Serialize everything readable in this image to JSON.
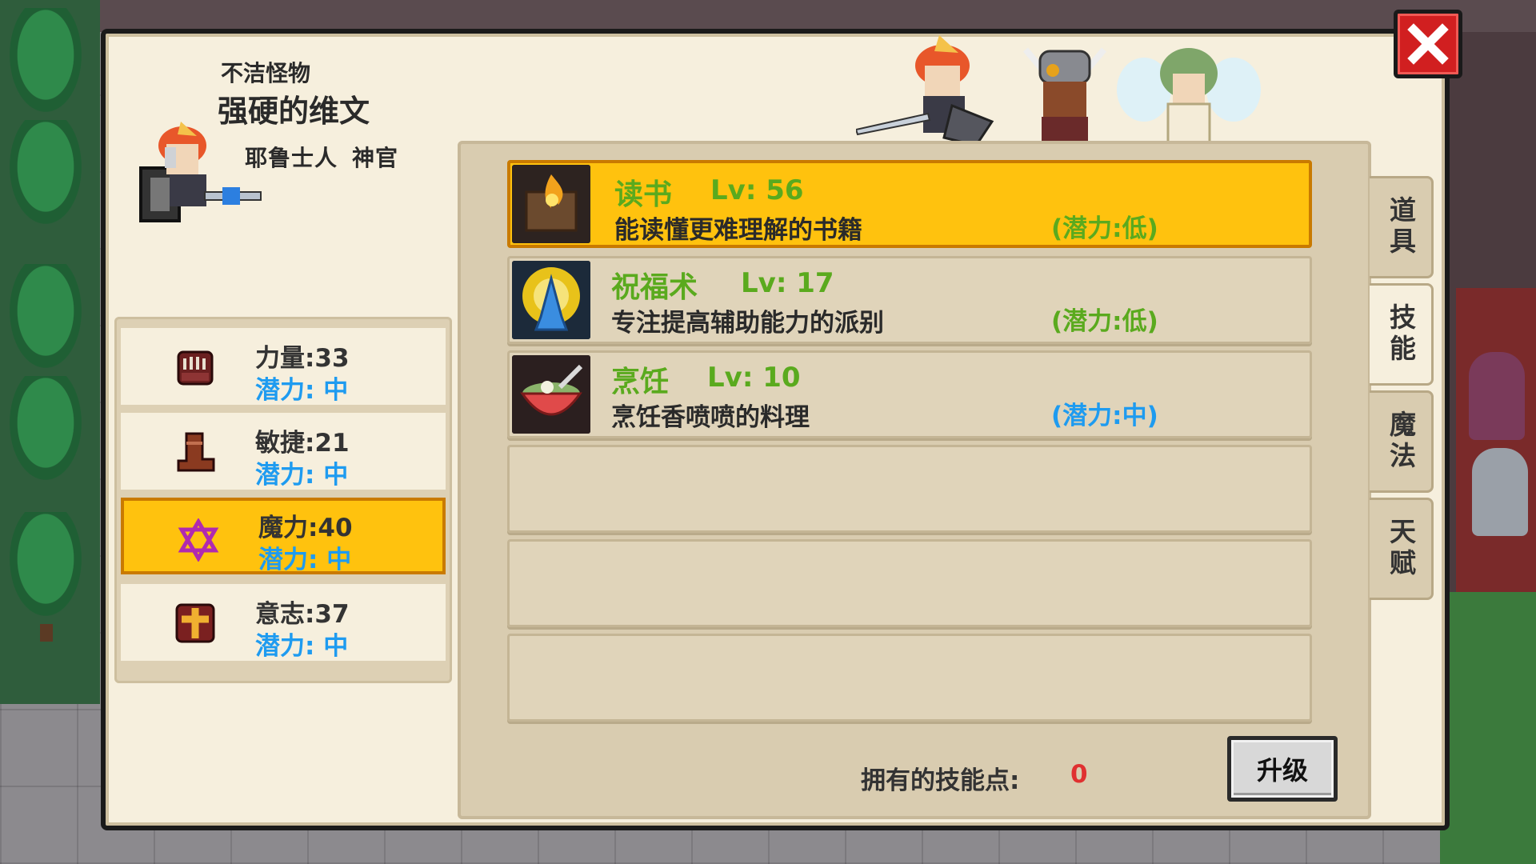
{
  "character": {
    "title": "不洁怪物",
    "name": "强硬的维文",
    "race": "耶鲁士人",
    "class": "神官"
  },
  "stats": [
    {
      "icon": "fist-icon",
      "name": "力量",
      "value": "33",
      "potential_label": "潜力",
      "potential": "中",
      "selected": false
    },
    {
      "icon": "boot-icon",
      "name": "敏捷",
      "value": "21",
      "potential_label": "潜力",
      "potential": "中",
      "selected": false
    },
    {
      "icon": "hexagram-icon",
      "name": "魔力",
      "value": "40",
      "potential_label": "潜力",
      "potential": "中",
      "selected": true
    },
    {
      "icon": "cross-shield-icon",
      "name": "意志",
      "value": "37",
      "potential_label": "潜力",
      "potential": "中",
      "selected": false
    }
  ],
  "skills": [
    {
      "icon": "book-fire-icon",
      "name": "读书",
      "level": "Lv: 56",
      "desc": "能读懂更难理解的书籍",
      "potential": "(潜力:低)",
      "selected": true
    },
    {
      "icon": "praying-hands-icon",
      "name": "祝福术",
      "level": "Lv: 17",
      "desc": "专注提高辅助能力的派别",
      "potential": "(潜力:低)",
      "selected": false
    },
    {
      "icon": "food-bowl-icon",
      "name": "烹饪",
      "level": "Lv: 10",
      "desc": "烹饪香喷喷的料理",
      "potential": "(潜力:中)",
      "selected": false
    }
  ],
  "empty_slots": 3,
  "skill_points": {
    "label": "拥有的技能点:",
    "value": "0"
  },
  "upgrade_label": "升级",
  "tabs": [
    {
      "label": "道具",
      "active": false
    },
    {
      "label": "技能",
      "active": true
    },
    {
      "label": "魔法",
      "active": false
    },
    {
      "label": "天赋",
      "active": false
    }
  ],
  "colors": {
    "highlight": "#ffc20e",
    "skill_green": "#5aaa1e",
    "potential_blue": "#1e9bf0",
    "close_red": "#d11f20",
    "points_red": "#e03030"
  }
}
